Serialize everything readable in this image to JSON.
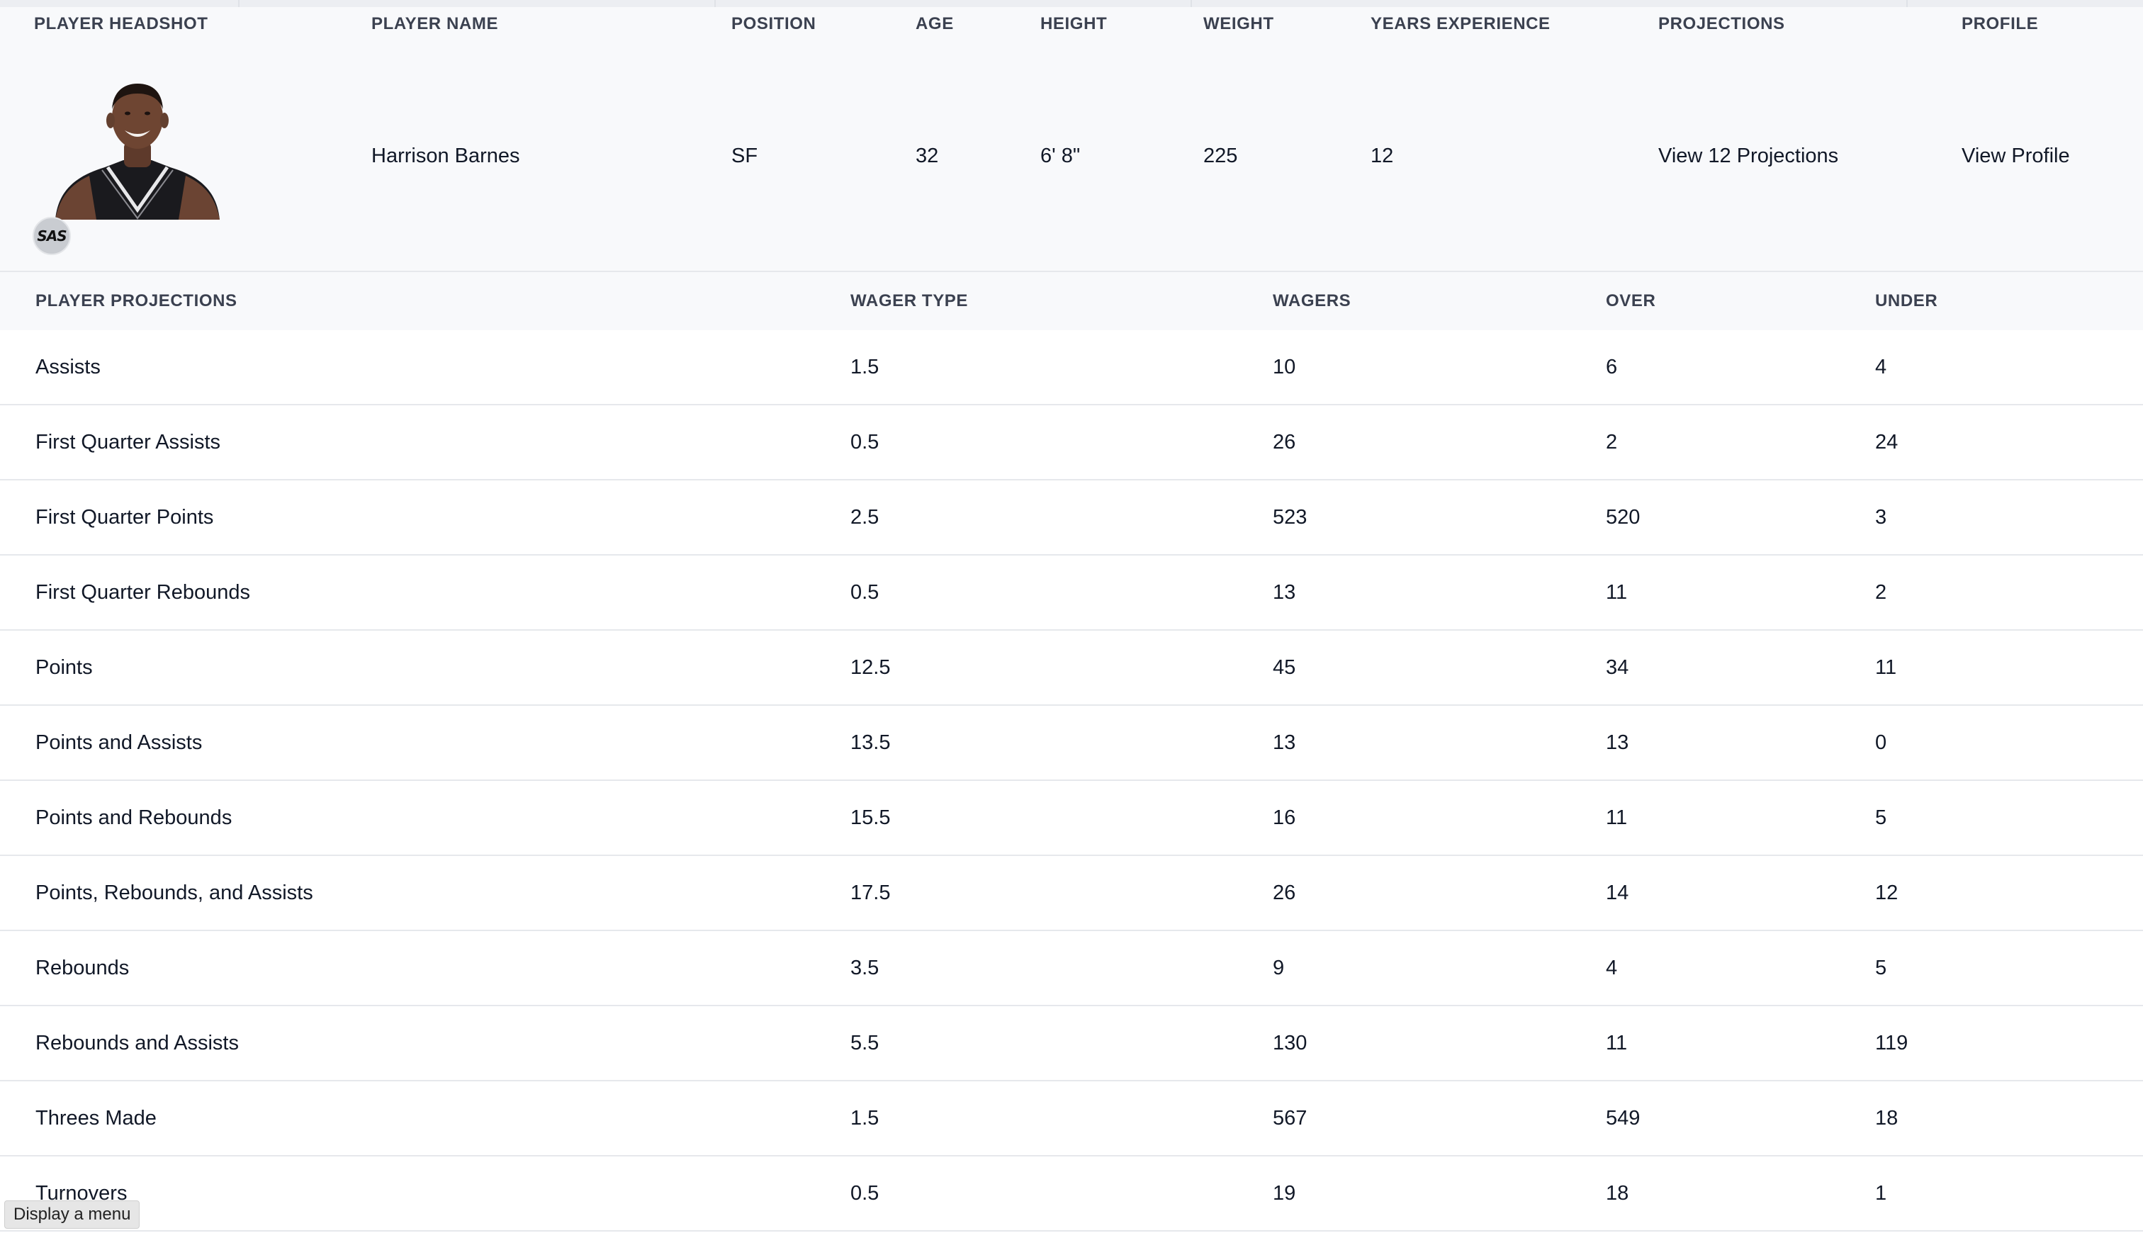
{
  "player_header": {
    "columns": {
      "headshot": "PLAYER HEADSHOT",
      "name": "PLAYER NAME",
      "position": "POSITION",
      "age": "AGE",
      "height": "HEIGHT",
      "weight": "WEIGHT",
      "years_experience": "YEARS EXPERIENCE",
      "projections": "PROJECTIONS",
      "profile": "PROFILE"
    },
    "player": {
      "team_badge": "SAS",
      "name": "Harrison Barnes",
      "position": "SF",
      "age": "32",
      "height": "6' 8\"",
      "weight": "225",
      "years_experience": "12",
      "projections_link": "View 12 Projections",
      "profile_link": "View Profile"
    }
  },
  "projections_table": {
    "columns": {
      "projection": "PLAYER PROJECTIONS",
      "wager_type": "WAGER TYPE",
      "wagers": "WAGERS",
      "over": "OVER",
      "under": "UNDER"
    },
    "rows": [
      {
        "projection": "Assists",
        "wager_type": "1.5",
        "wagers": "10",
        "over": "6",
        "under": "4"
      },
      {
        "projection": "First Quarter Assists",
        "wager_type": "0.5",
        "wagers": "26",
        "over": "2",
        "under": "24"
      },
      {
        "projection": "First Quarter Points",
        "wager_type": "2.5",
        "wagers": "523",
        "over": "520",
        "under": "3"
      },
      {
        "projection": "First Quarter Rebounds",
        "wager_type": "0.5",
        "wagers": "13",
        "over": "11",
        "under": "2"
      },
      {
        "projection": "Points",
        "wager_type": "12.5",
        "wagers": "45",
        "over": "34",
        "under": "11"
      },
      {
        "projection": "Points and Assists",
        "wager_type": "13.5",
        "wagers": "13",
        "over": "13",
        "under": "0"
      },
      {
        "projection": "Points and Rebounds",
        "wager_type": "15.5",
        "wagers": "16",
        "over": "11",
        "under": "5"
      },
      {
        "projection": "Points, Rebounds, and Assists",
        "wager_type": "17.5",
        "wagers": "26",
        "over": "14",
        "under": "12"
      },
      {
        "projection": "Rebounds",
        "wager_type": "3.5",
        "wagers": "9",
        "over": "4",
        "under": "5"
      },
      {
        "projection": "Rebounds and Assists",
        "wager_type": "5.5",
        "wagers": "130",
        "over": "11",
        "under": "119"
      },
      {
        "projection": "Threes Made",
        "wager_type": "1.5",
        "wagers": "567",
        "over": "549",
        "under": "18"
      },
      {
        "projection": "Turnovers",
        "wager_type": "0.5",
        "wagers": "19",
        "over": "18",
        "under": "1"
      }
    ]
  },
  "tooltip": {
    "menu_hint": "Display a menu"
  },
  "colors": {
    "header_bg": "#f8f9fb",
    "header_text": "#3b4150",
    "row_border": "#e6e8ec",
    "body_text": "#111827"
  }
}
